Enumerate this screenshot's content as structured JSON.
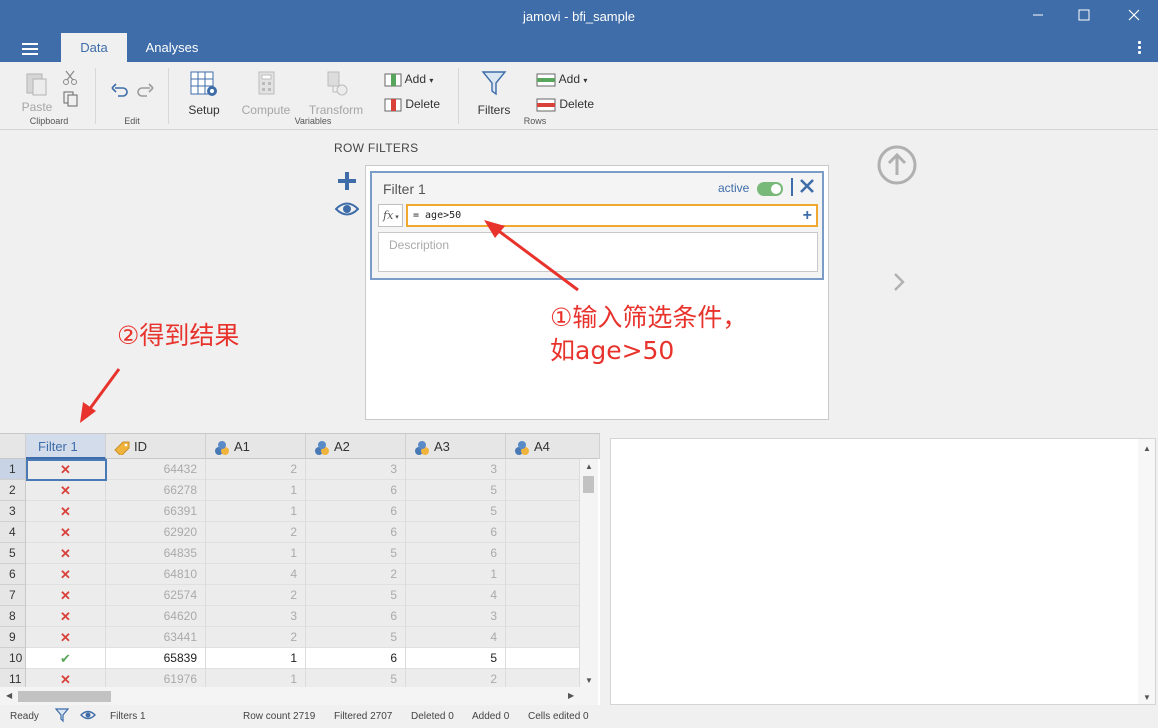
{
  "window": {
    "title": "jamovi - bfi_sample"
  },
  "tabs": [
    {
      "label": "Data"
    },
    {
      "label": "Analyses"
    }
  ],
  "ribbon": {
    "clipboard": {
      "paste": "Paste",
      "group": "Clipboard"
    },
    "edit": {
      "group": "Edit"
    },
    "variables": {
      "setup": "Setup",
      "compute": "Compute",
      "transform": "Transform",
      "add": "Add",
      "delete": "Delete",
      "group": "Variables"
    },
    "rows": {
      "filters": "Filters",
      "add": "Add",
      "delete": "Delete",
      "group": "Rows"
    }
  },
  "filters_panel": {
    "title": "ROW FILTERS",
    "filter": {
      "name": "Filter 1",
      "active_label": "active",
      "active": true,
      "formula": "= age>50",
      "description_placeholder": "Description"
    }
  },
  "annotations": {
    "input_hint_line1": "①输入筛选条件，",
    "input_hint_line2": "如age>50",
    "result_hint": "②得到结果"
  },
  "sheet": {
    "columns": [
      "Filter 1",
      "ID",
      "A1",
      "A2",
      "A3",
      "A4"
    ],
    "rows": [
      {
        "n": "1",
        "pass": false,
        "id": "64432",
        "a1": "2",
        "a2": "3",
        "a3": "3"
      },
      {
        "n": "2",
        "pass": false,
        "id": "66278",
        "a1": "1",
        "a2": "6",
        "a3": "5"
      },
      {
        "n": "3",
        "pass": false,
        "id": "66391",
        "a1": "1",
        "a2": "6",
        "a3": "5"
      },
      {
        "n": "4",
        "pass": false,
        "id": "62920",
        "a1": "2",
        "a2": "6",
        "a3": "6"
      },
      {
        "n": "5",
        "pass": false,
        "id": "64835",
        "a1": "1",
        "a2": "5",
        "a3": "6"
      },
      {
        "n": "6",
        "pass": false,
        "id": "64810",
        "a1": "4",
        "a2": "2",
        "a3": "1"
      },
      {
        "n": "7",
        "pass": false,
        "id": "62574",
        "a1": "2",
        "a2": "5",
        "a3": "4"
      },
      {
        "n": "8",
        "pass": false,
        "id": "64620",
        "a1": "3",
        "a2": "6",
        "a3": "3"
      },
      {
        "n": "9",
        "pass": false,
        "id": "63441",
        "a1": "2",
        "a2": "5",
        "a3": "4"
      },
      {
        "n": "10",
        "pass": true,
        "id": "65839",
        "a1": "1",
        "a2": "6",
        "a3": "5"
      },
      {
        "n": "11",
        "pass": false,
        "id": "61976",
        "a1": "1",
        "a2": "5",
        "a3": "2"
      }
    ]
  },
  "status": {
    "ready": "Ready",
    "filters": "Filters 1",
    "row_count": "Row count 2719",
    "filtered": "Filtered 2707",
    "deleted": "Deleted 0",
    "added": "Added 0",
    "edited": "Cells edited 0"
  },
  "colors": {
    "brand": "#3e6da9",
    "annotation": "#e8332d",
    "active_toggle": "#78b97a",
    "formula_border": "#f0a830"
  }
}
